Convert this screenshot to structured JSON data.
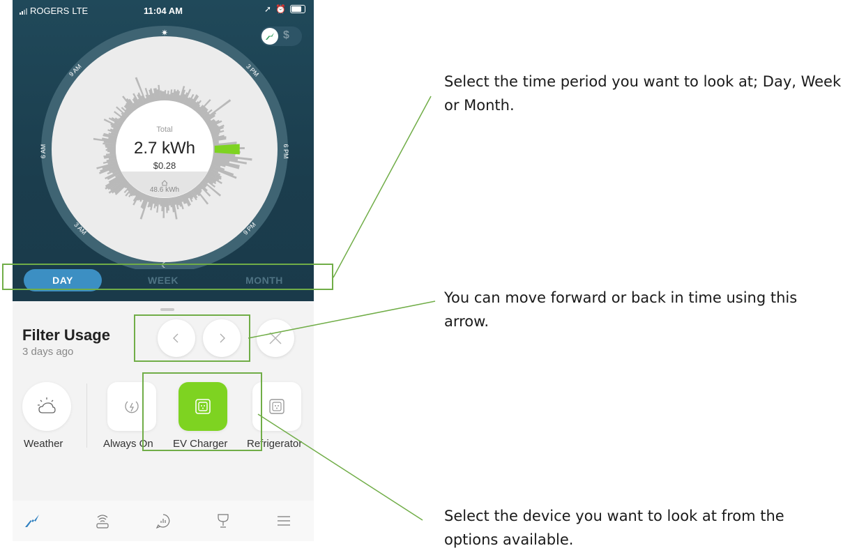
{
  "status_bar": {
    "carrier": "ROGERS",
    "network": "LTE",
    "time": "11:04 AM"
  },
  "chart": {
    "total_label": "Total",
    "total_value": "2.7 kWh",
    "total_cost": "$0.28",
    "home_value": "48.6 kWh",
    "hour_labels": [
      "9 AM",
      "3 PM",
      "6 AM",
      "6 PM",
      "3 AM",
      "9 PM"
    ]
  },
  "period_tabs": [
    {
      "label": "DAY",
      "active": true
    },
    {
      "label": "WEEK",
      "active": false
    },
    {
      "label": "MONTH",
      "active": false
    }
  ],
  "mode_toggle": {
    "options": [
      "usage",
      "$"
    ],
    "selected": "usage"
  },
  "filter": {
    "title": "Filter Usage",
    "subtitle": "3 days ago"
  },
  "devices": [
    {
      "label": "Weather",
      "icon": "weather-icon",
      "selected": false
    },
    {
      "label": "Always On",
      "icon": "always-on-icon",
      "selected": false
    },
    {
      "label": "EV Charger",
      "icon": "outlet-icon",
      "selected": true
    },
    {
      "label": "Refrigerator",
      "icon": "outlet-icon",
      "selected": false
    }
  ],
  "tab_bar": [
    {
      "name": "usage",
      "icon": "usage-icon",
      "active": true
    },
    {
      "name": "device",
      "icon": "sense-device-icon",
      "active": false
    },
    {
      "name": "chat",
      "icon": "chat-icon",
      "active": false
    },
    {
      "name": "goals",
      "icon": "trophy-icon",
      "active": false
    },
    {
      "name": "menu",
      "icon": "menu-icon",
      "active": false
    }
  ],
  "annotations": {
    "period": "Select the time period you want to look at; Day, Week or Month.",
    "arrows": "You can move forward or back in time using this arrow.",
    "device": "Select the device you want to look at from the options available."
  },
  "colors": {
    "panel": "#1b3d4d",
    "accent_green": "#7ed321",
    "accent_blue": "#3c8fc3",
    "callout": "#70ad47",
    "usage_icon": "#2f80c0"
  }
}
